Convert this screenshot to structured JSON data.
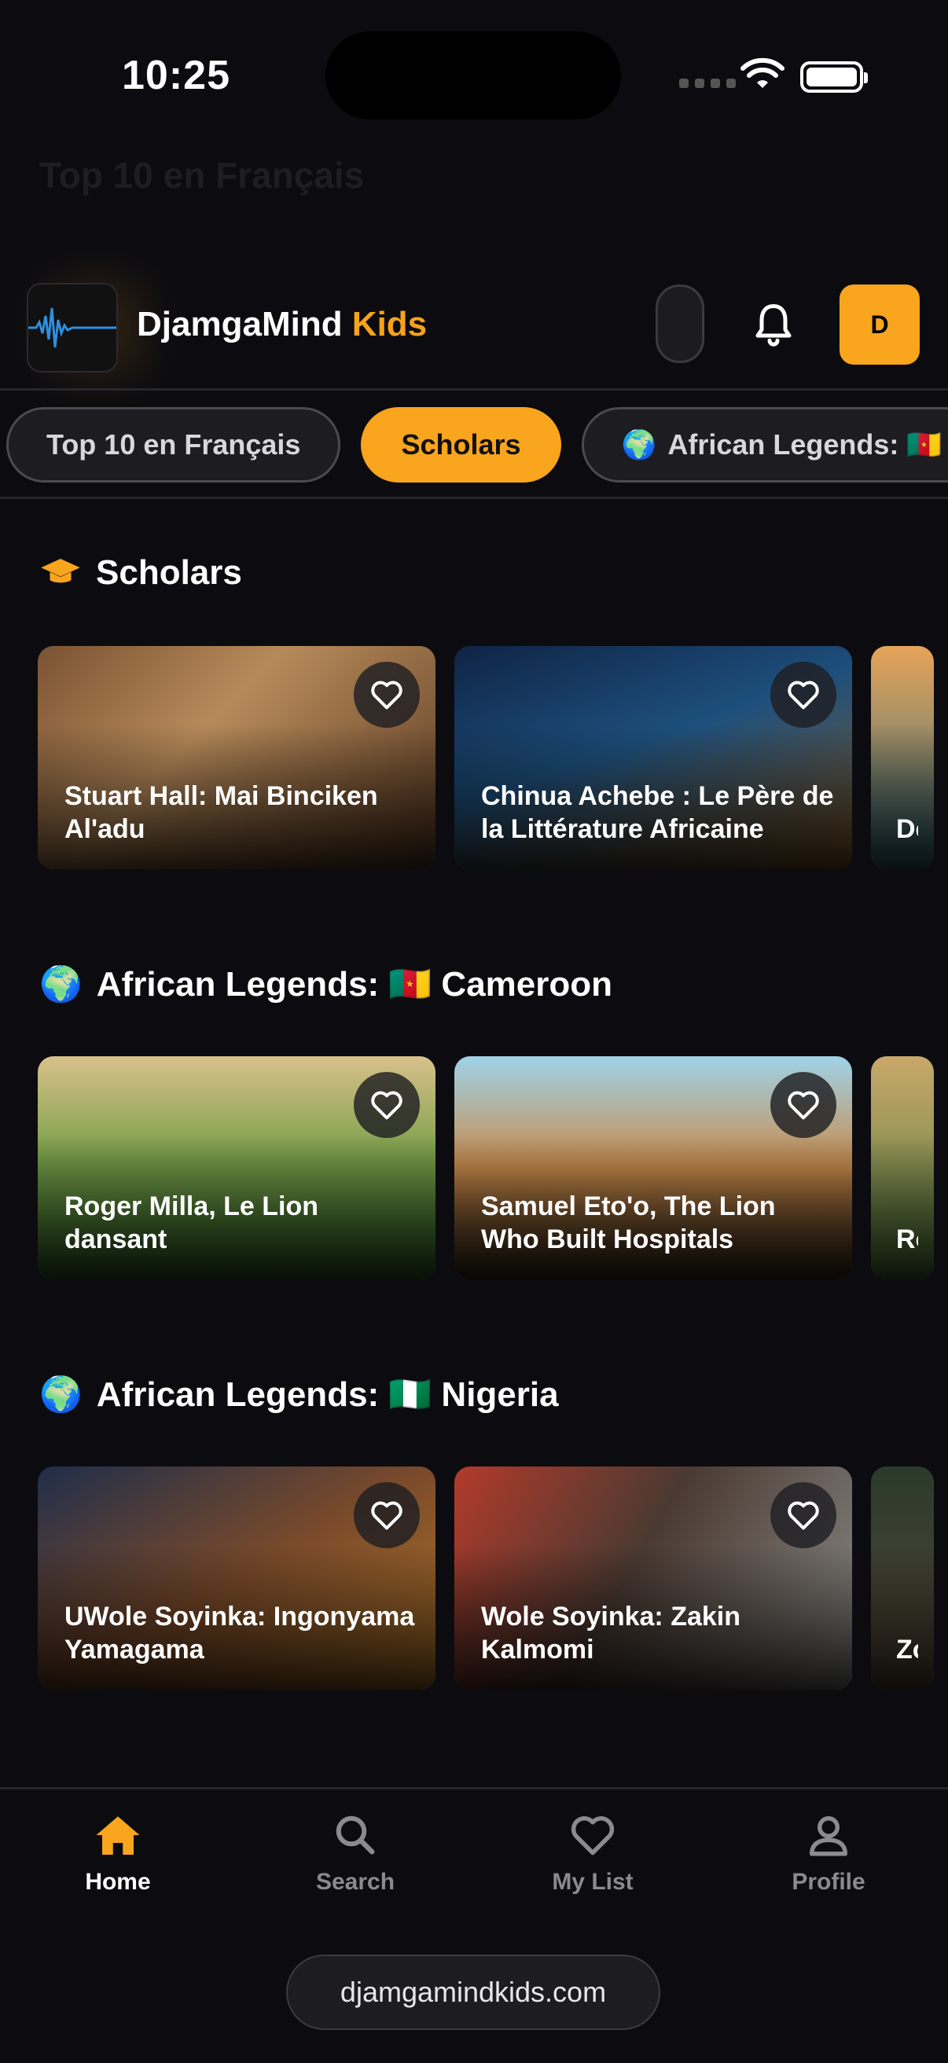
{
  "status_bar": {
    "time": "10:25"
  },
  "background_header": {
    "title": "Top 10 en Français"
  },
  "header": {
    "brand_primary": "DjamgaMind",
    "brand_secondary": " Kids",
    "avatar_initial": "D"
  },
  "tabs": [
    {
      "label": "Top 10 en Français",
      "active": false
    },
    {
      "label": "Scholars",
      "active": true
    },
    {
      "label": "African Legends: 🇨🇲",
      "active": false,
      "icon": "globe-icon"
    }
  ],
  "sections": [
    {
      "title": "Scholars",
      "icon": "graduation-cap-icon",
      "cards": [
        {
          "title": "Stuart Hall: Mai Binciken Al'adu"
        },
        {
          "title": "Chinua Achebe : Le Père de la Littérature Africaine"
        },
        {
          "title": "Dere de F"
        }
      ]
    },
    {
      "title": "African Legends: 🇨🇲 Cameroon",
      "icon": "globe-icon",
      "cards": [
        {
          "title": "Roger Milla, Le Lion dansant"
        },
        {
          "title": "Samuel Eto'o, The Lion Who Built Hospitals"
        },
        {
          "title": "Rog Ana"
        }
      ]
    },
    {
      "title": "African Legends: 🇳🇬 Nigeria",
      "icon": "globe-icon",
      "cards": [
        {
          "title": "UWole Soyinka: Ingonyama Yamagama"
        },
        {
          "title": "Wole Soyinka: Zakin Kalmomi"
        },
        {
          "title": "Zola Blan"
        }
      ]
    }
  ],
  "bottom_nav": [
    {
      "label": "Home",
      "icon": "home-icon",
      "active": true
    },
    {
      "label": "Search",
      "icon": "search-icon",
      "active": false
    },
    {
      "label": "My List",
      "icon": "heart-icon",
      "active": false
    },
    {
      "label": "Profile",
      "icon": "profile-icon",
      "active": false
    }
  ],
  "url_bar": {
    "url": "djamgamindkids.com"
  },
  "colors": {
    "accent": "#f9a51d",
    "background": "#0c0c10"
  }
}
